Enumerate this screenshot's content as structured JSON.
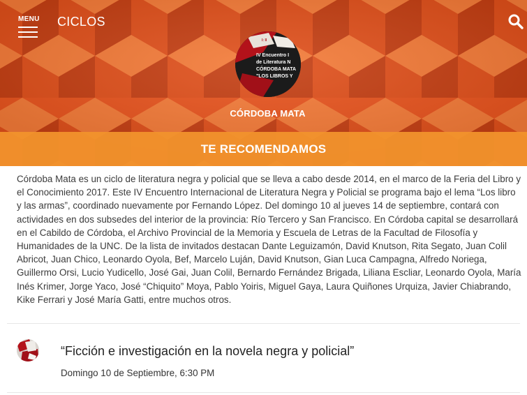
{
  "header": {
    "menu_label": "MENU",
    "section_title": "CICLOS",
    "search_icon": "search-icon",
    "menu_icon": "hamburger-icon"
  },
  "hero": {
    "background_color": "#e8531d",
    "cycle_name": "CÓRDOBA MATA",
    "avatar_lines": [
      "IV Encuentro I",
      "de Literatura N",
      "CÓRDOBA MATA",
      "\"LOS LIBROS Y"
    ]
  },
  "recommend": {
    "label": "TE RECOMENDAMOS",
    "color": "#f1922c"
  },
  "description": {
    "text": "Córdoba Mata es un ciclo de literatura negra y policial que se lleva a cabo desde 2014, en el marco de la Feria del Libro y el Conocimiento 2017. Este IV Encuentro Internacional de Literatura Negra y Policial se programa bajo el lema “Los libro y las armas”, coordinado nuevamente por Fernando López. Del domingo 10 al jueves 14 de septiembre, contará con actividades en dos subsedes del interior de la provincia: Río Tercero y San Francisco. En Córdoba capital se desarrollará en el Cabildo de Córdoba, el Archivo Provincial de la Memoria y Escuela de Letras de la Facultad de Filosofía y Humanidades de la UNC. De la lista de invitados destacan Dante Leguizamón, David Knutson, Rita Segato, Juan Colil Abricot, Juan Chico, Leonardo Oyola, Bef, Marcelo Luján, David Knutson, Gian Luca Campagna, Alfredo Noriega, Guillermo Orsi, Lucio Yudicello, José Gai, Juan Colil, Bernardo Fernández Brigada, Liliana Escliar, Leonardo Oyola, María Inés Krimer, Jorge Yaco, José “Chiquito” Moya, Pablo Yoiris, Miguel Gaya, Laura Quiñones Urquiza, Javier Chiabrando, Kike Ferrari y José María Gatti, entre muchos otros."
  },
  "events": [
    {
      "title": "“Ficción e investigación en la novela negra y policial”",
      "date": "Domingo 10 de Septiembre, 6:30 PM"
    }
  ]
}
